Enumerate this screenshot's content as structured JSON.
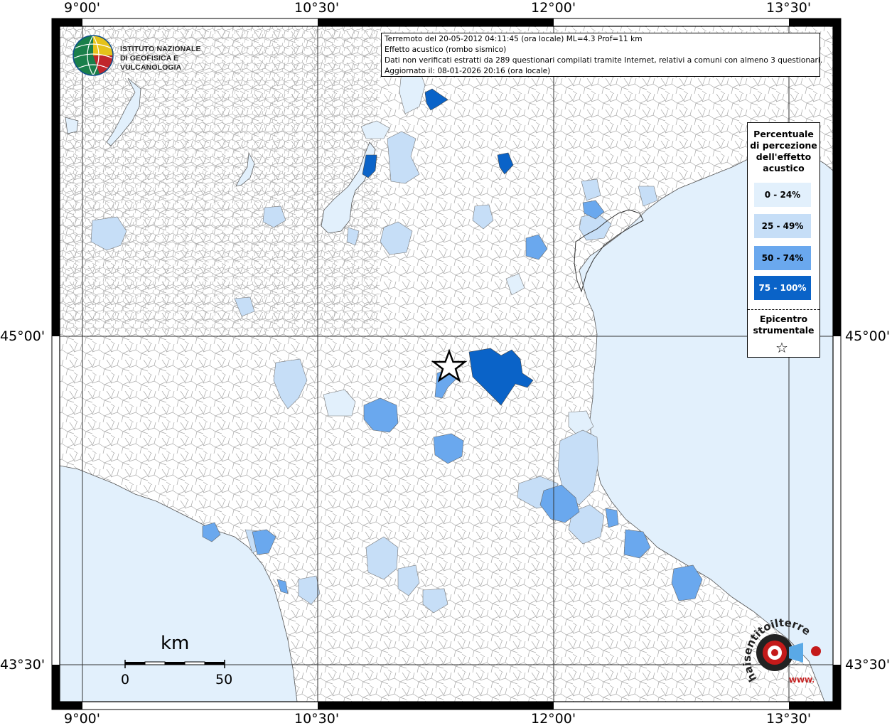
{
  "map": {
    "top_labels": [
      "9°00'",
      "10°30'",
      "12°00'",
      "13°30'"
    ],
    "bottom_labels": [
      "9°00'",
      "10°30'",
      "12°00'",
      "13°30'"
    ],
    "left_labels": [
      "45°00'",
      "43°30'"
    ],
    "right_labels": [
      "45°00'",
      "43°30'"
    ],
    "colors": {
      "sea": "#e2f0fc",
      "level_0_24": "#e2f0fc",
      "level_25_49": "#c6def7",
      "level_50_74": "#6aa8ee",
      "level_75_100": "#0a63c8",
      "borders": "#9a9a9a"
    }
  },
  "info": {
    "line1": "Terremoto del 20-05-2012 04:11:45 (ora locale) ML=4.3 Prof=11 km",
    "line2": "Effetto acustico (rombo sismico)",
    "line3": "Dati non verificati estratti da 289 questionari compilati tramite Internet, relativi a comuni con almeno 3 questionari.",
    "line4": "Aggiornato il: 08-01-2026 20:16 (ora locale)"
  },
  "logo": {
    "line1": "ISTITUTO NAZIONALE",
    "line2": "DI GEOFISICA E VULCANOLOGIA"
  },
  "legend": {
    "title_lines": [
      "Percentuale",
      "di percezione",
      "dell'effetto",
      "acustico"
    ],
    "items": [
      {
        "label": "0 - 24%",
        "color": "#e2f0fc"
      },
      {
        "label": "25 - 49%",
        "color": "#c6def7"
      },
      {
        "label": "50 - 74%",
        "color": "#6aa8ee"
      },
      {
        "label": "75 - 100%",
        "color": "#0a63c8"
      }
    ],
    "epicenter_lines": [
      "Epicentro",
      "strumentale"
    ],
    "epicenter_symbol": "☆"
  },
  "scalebar": {
    "unit": "km",
    "start": "0",
    "end": "50"
  },
  "haisentito": {
    "text": "haisentitoilterremoto.it",
    "www": "WWW."
  }
}
